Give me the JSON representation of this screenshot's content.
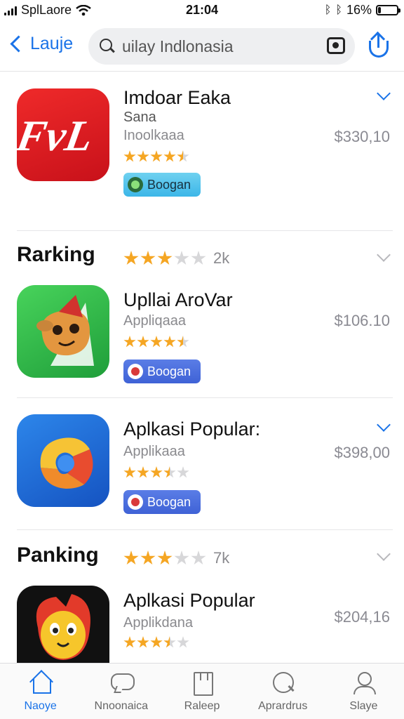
{
  "status_bar": {
    "carrier": "SplLaore",
    "time": "21:04",
    "battery_text": "16%",
    "battery_level": 0.16
  },
  "header": {
    "back_label": "Lauje",
    "search_value": "uilay Indlonasia"
  },
  "apps": [
    {
      "title": "Imdoar Eaka",
      "subtitle": "Sana",
      "category": "Inoolkaaa",
      "price": "$330,10",
      "rating": 4.5,
      "button_label": "Boogan",
      "icon": "fvl-logo-icon",
      "icon_color": "#e0191c",
      "expanded": true
    },
    {
      "title": "Upllai AroVar",
      "category": "Appliqaaa",
      "price": "$106.10",
      "rating": 4.5,
      "button_label": "Boogan",
      "icon": "mascot-icon",
      "icon_color": "#2fb84a",
      "expanded": false
    },
    {
      "title": "Aplkasi Popular:",
      "category": "Applikaaa",
      "price": "$398,00",
      "rating": 3.5,
      "button_label": "Boogan",
      "icon": "swirl-logo-icon",
      "icon_color": "#1e6fd6",
      "expanded": true
    },
    {
      "title": "Aplkasi Popular",
      "category": "Applikdana",
      "price": "$204,16",
      "rating": 3.5,
      "icon": "bird-mascot-icon",
      "icon_color": "#111111",
      "expanded": false
    }
  ],
  "sections": [
    {
      "title": "Rarking",
      "rating": 3,
      "count": "2k"
    },
    {
      "title": "Panking",
      "rating": 3,
      "count": "7k"
    }
  ],
  "tabs": [
    {
      "label": "Naoye",
      "icon": "home-icon",
      "active": true
    },
    {
      "label": "Nnoonaica",
      "icon": "chat-icon",
      "active": false
    },
    {
      "label": "Raleep",
      "icon": "book-icon",
      "active": false
    },
    {
      "label": "Aprardrus",
      "icon": "search-heart-icon",
      "active": false
    },
    {
      "label": "Slaye",
      "icon": "user-icon",
      "active": false
    }
  ],
  "colors": {
    "accent": "#1a73e8",
    "star": "#f5a623"
  }
}
